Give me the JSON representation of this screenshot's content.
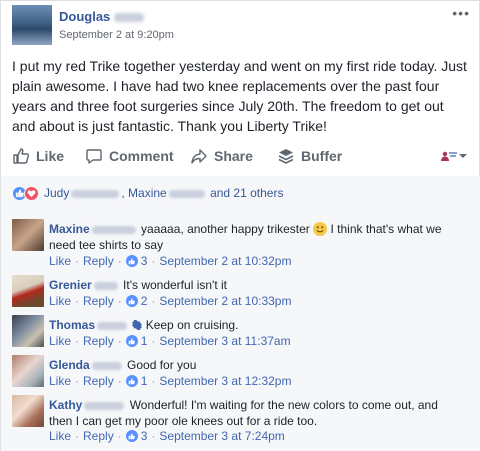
{
  "post": {
    "author_first": "Douglas",
    "timestamp": "September 2 at 9:20pm",
    "more_icon": "more-horizontal-icon",
    "body": "I put my red Trike together yesterday and went on my first ride today. Just plain awesome. I have had two knee replacements over the past four years and three foot surgeries since July 20th. The freedom to get out and about is just fantastic. Thank you Liberty Trike!"
  },
  "actions": {
    "like": "Like",
    "comment": "Comment",
    "share": "Share",
    "buffer": "Buffer",
    "audience_icon": "audience-selector-icon"
  },
  "reactions": {
    "name1_first": "Judy",
    "name2_first": "Maxine",
    "others": "and 21 others",
    "icons": [
      "like-icon",
      "love-icon"
    ]
  },
  "comments": [
    {
      "name_first": "Maxine",
      "text_before_emoji": "yaaaaa, another happy trikester",
      "text_after_emoji": "I think that's what we need tee shirts to say",
      "like": "Like",
      "reply": "Reply",
      "likes": "3",
      "time": "September 2 at 10:32pm"
    },
    {
      "name_first": "Grenier",
      "text": "It's wonderful isn't it",
      "like": "Like",
      "reply": "Reply",
      "likes": "2",
      "time": "September 2 at 10:33pm"
    },
    {
      "name_first": "Thomas",
      "text": "Keep on cruising.",
      "like": "Like",
      "reply": "Reply",
      "likes": "1",
      "time": "September 3 at 11:37am"
    },
    {
      "name_first": "Glenda",
      "text": "Good for you",
      "like": "Like",
      "reply": "Reply",
      "likes": "1",
      "time": "September 3 at 12:32pm"
    },
    {
      "name_first": "Kathy",
      "text": "Wonderful! I'm waiting for the new colors to come out, and then I can get my poor ole knees out for a ride too.",
      "like": "Like",
      "reply": "Reply",
      "likes": "3",
      "time": "September 3 at 7:24pm"
    }
  ],
  "colors": {
    "link": "#365899",
    "action_blue": "#4267b2",
    "muted": "#90949c",
    "like_blue": "#5890ff",
    "love_red": "#f25268"
  }
}
